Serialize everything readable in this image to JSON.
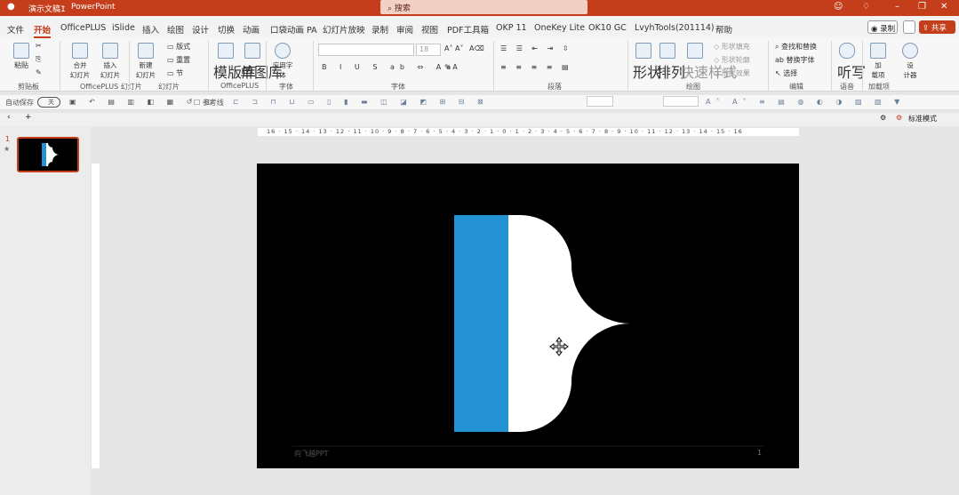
{
  "titlebar": {
    "doc_name": "演示文稿1",
    "separator": "-",
    "app_name": "PowerPoint",
    "search_placeholder": "搜索"
  },
  "menubar": {
    "items": [
      {
        "label": "文件",
        "active": false
      },
      {
        "label": "开始",
        "active": true
      },
      {
        "label": "OfficePLUS",
        "active": false
      },
      {
        "label": "iSlide",
        "active": false
      },
      {
        "label": "插入",
        "active": false
      },
      {
        "label": "绘图",
        "active": false
      },
      {
        "label": "设计",
        "active": false
      },
      {
        "label": "切换",
        "active": false
      },
      {
        "label": "动画",
        "active": false
      },
      {
        "label": "口袋动画 PA",
        "active": false
      },
      {
        "label": "幻灯片放映",
        "active": false
      },
      {
        "label": "录制",
        "active": false
      },
      {
        "label": "审阅",
        "active": false
      },
      {
        "label": "视图",
        "active": false
      },
      {
        "label": "PDF工具箱",
        "active": false
      },
      {
        "label": "OKP 11",
        "active": false
      },
      {
        "label": "OneKey Lite",
        "active": false
      },
      {
        "label": "OK10 GC",
        "active": false
      },
      {
        "label": "LvyhTools(201114)",
        "active": false
      },
      {
        "label": "帮助",
        "active": false
      }
    ],
    "record_label": "录制",
    "share_label": "共享"
  },
  "ribbon": {
    "paste": "粘贴",
    "new_slide_combo": "合并\n幻灯片",
    "insert_slide": "插入\n幻灯片",
    "new_slide": "新建\n幻灯片",
    "layout": "版式",
    "reset": "重置",
    "section": "节",
    "template_lib": "模版库",
    "single_image_lib": "单图库",
    "apply_font": "应用字\n体",
    "shape": "形状",
    "arrange": "排列",
    "quick_style": "快速样式",
    "shape_fill": "形状填充",
    "shape_outline": "形状轮廓",
    "shape_effect": "形状效果",
    "find_replace": "查找和替换",
    "replace_font": "替换字体",
    "select": "选择",
    "dictate": "听写",
    "addins": "加\n载项",
    "designer": "设\n计器",
    "groups": [
      "剪贴板",
      "OfficePLUS 幻灯片",
      "幻灯片",
      "OfficePLUS",
      "字体",
      "字体",
      "段落",
      "绘图",
      "编辑",
      "语音",
      "加载项"
    ],
    "font_name": "",
    "font_size": "18"
  },
  "qat": {
    "autosave": "自动保存",
    "autosave_state": "关",
    "reference_line": "参考线"
  },
  "tabstrip": {
    "add": "+",
    "right_label": "标准模式"
  },
  "thumbnails": {
    "number": "1",
    "star": "★"
  },
  "ruler_h": "16 · 15 · 14 · 13 · 12 · 11 · 10 · 9 · 8 · 7 · 6 · 5 · 4 · 3 · 2 · 1 · 0 · 1 · 2 · 3 · 4 · 5 · 6 · 7 · 8 · 9 · 10 · 11 · 12 · 13 · 14 · 15 · 16",
  "slide": {
    "footer_text": "向飞越PPT",
    "page_number": "1",
    "blue_color": "#2491d2",
    "bg_color": "#000000",
    "shape_color": "#ffffff"
  }
}
